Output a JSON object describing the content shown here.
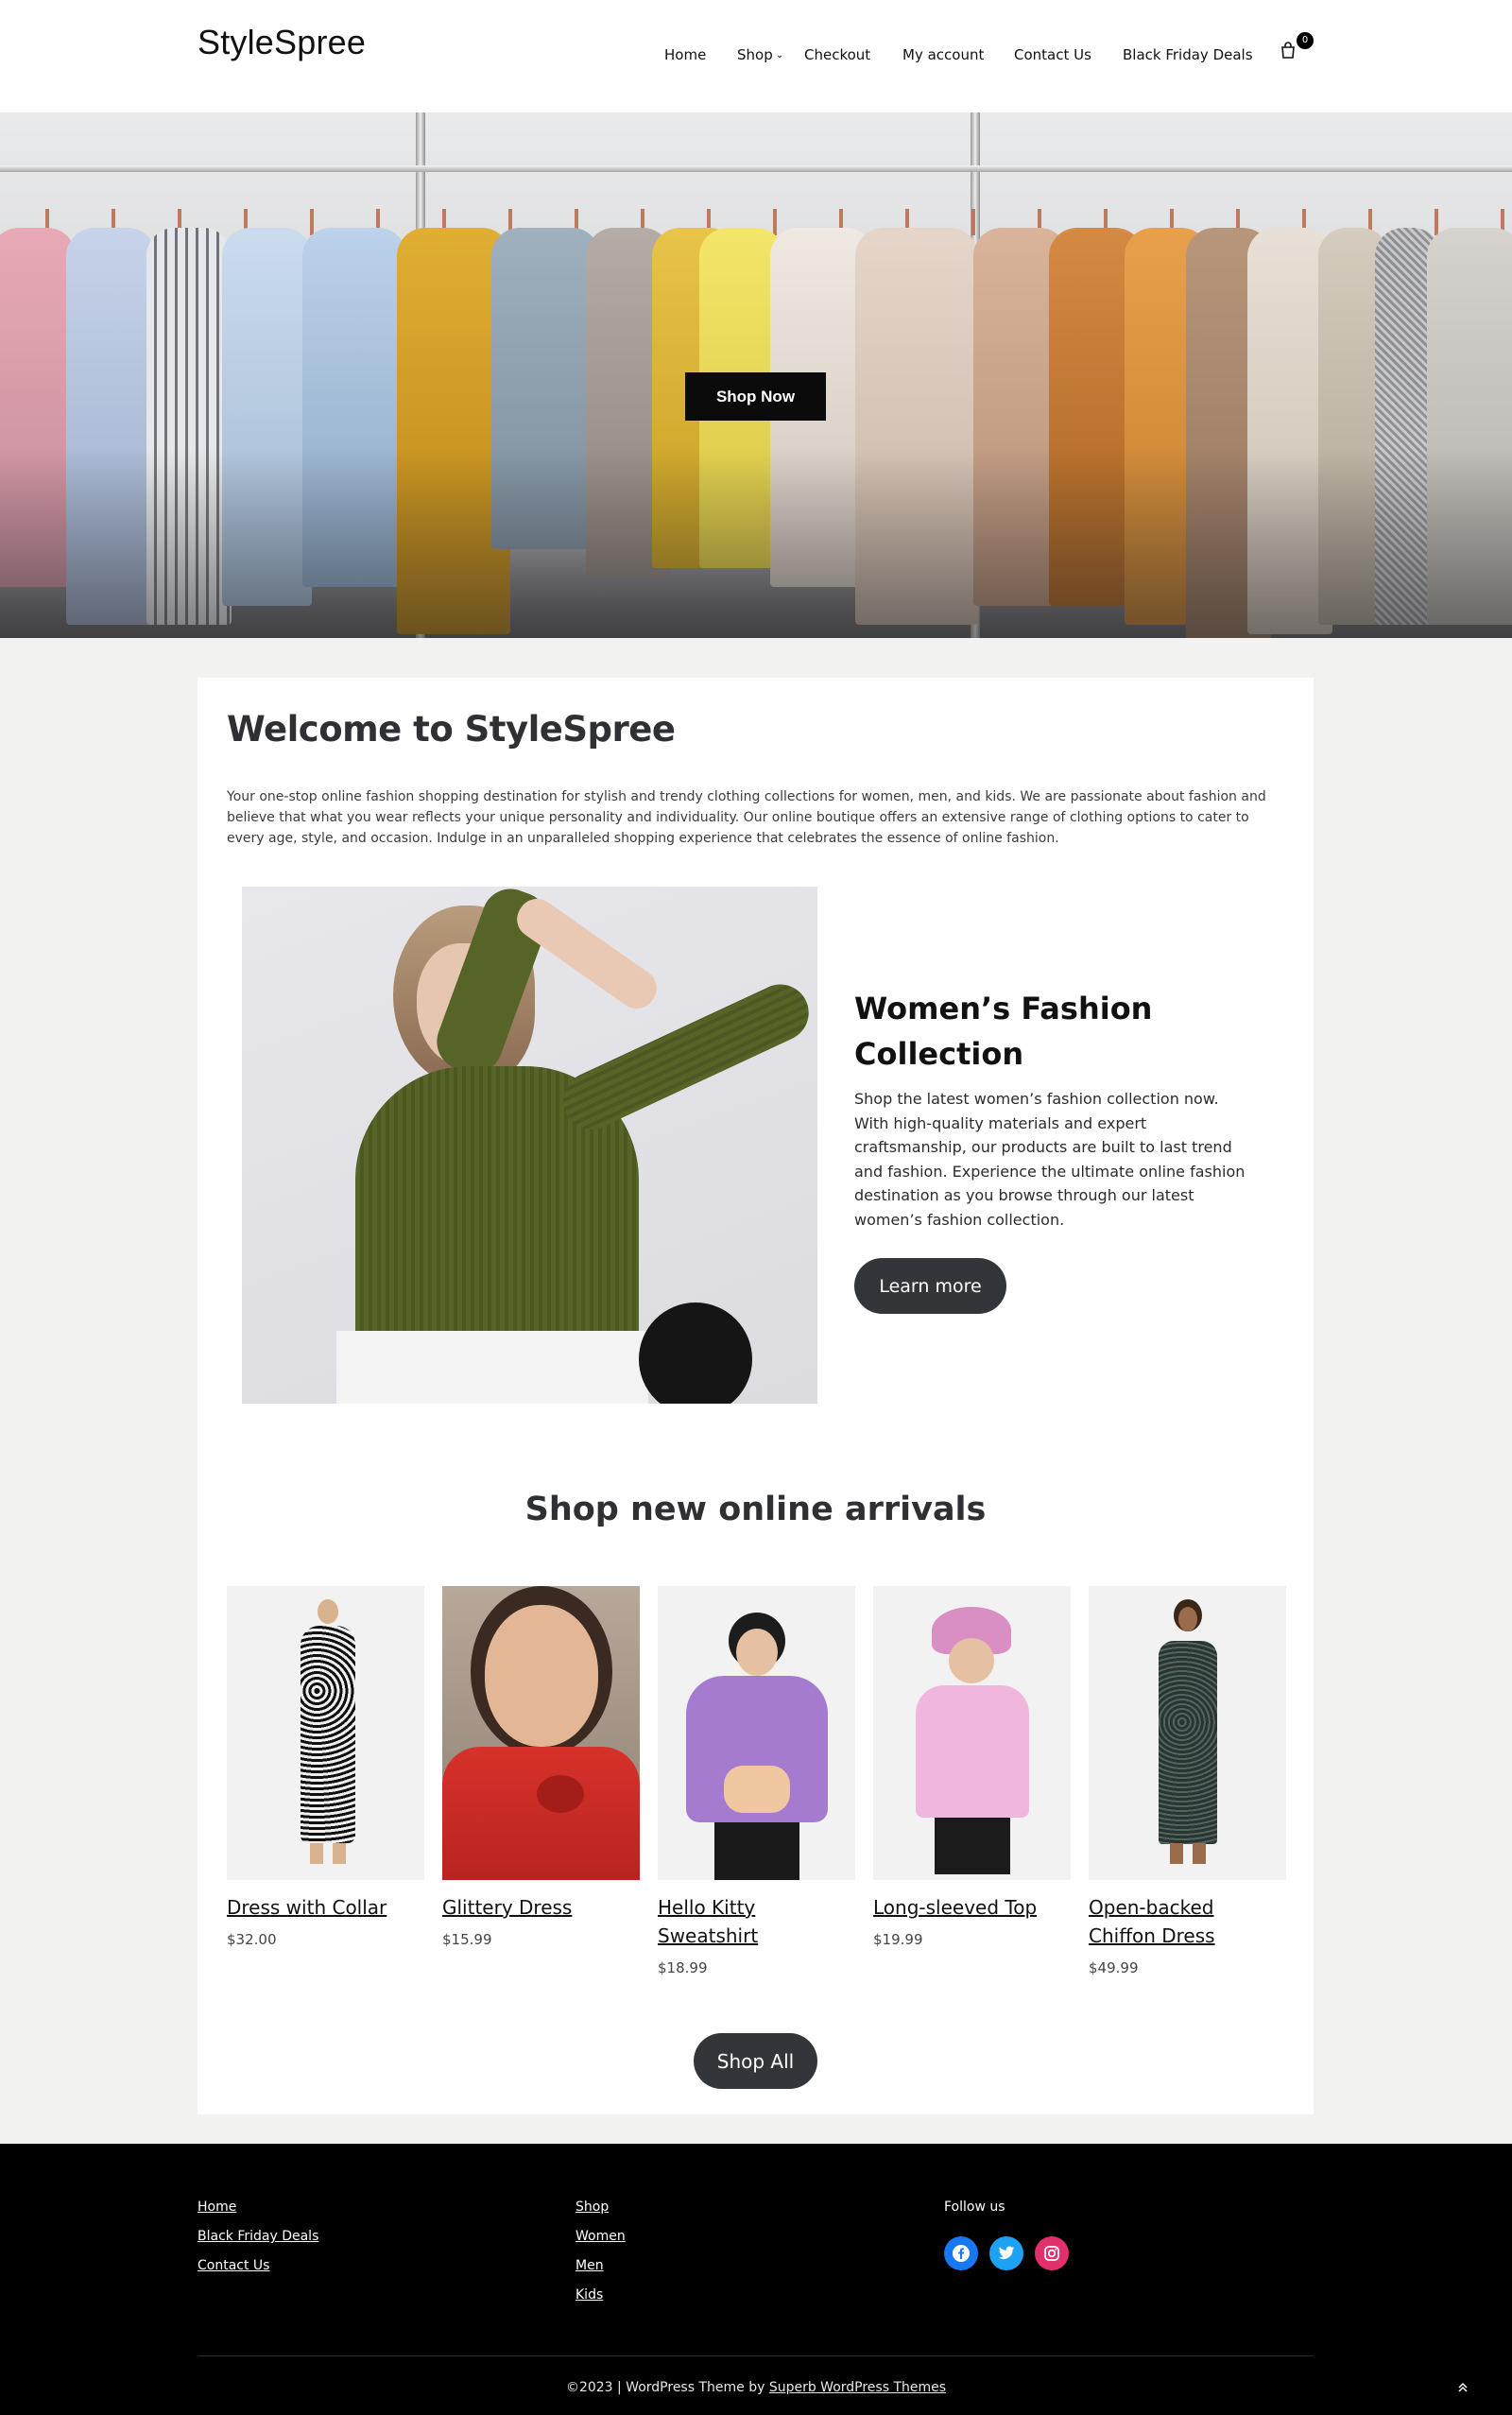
{
  "header": {
    "site_title": "StyleSpree",
    "nav": [
      {
        "label": "Home"
      },
      {
        "label": "Shop",
        "has_dropdown": true
      },
      {
        "label": "Checkout"
      },
      {
        "label": "My account"
      },
      {
        "label": "Contact Us"
      },
      {
        "label": "Black Friday Deals"
      }
    ],
    "cart_count": "0",
    "cart_icon": "shopping-bag-icon"
  },
  "hero": {
    "button_label": "Shop Now"
  },
  "welcome": {
    "title": "Welcome to StyleSpree",
    "text": "Your one-stop online fashion shopping destination for stylish and trendy clothing collections for women, men, and kids. We are passionate about fashion and believe that what you wear reflects your unique personality and individuality. Our online boutique offers an extensive range of clothing options to cater to every age, style, and occasion. Indulge in an unparalleled shopping experience that celebrates the essence of online fashion."
  },
  "feature": {
    "title": "Women’s Fashion Collection",
    "text": "Shop the latest women’s fashion collection now. With high-quality materials and expert craftsmanship, our products are built to last trend and fashion. Experience the ultimate online fashion destination as you browse through our latest women’s fashion collection.",
    "button_label": "Learn more"
  },
  "arrivals": {
    "title": "Shop new online arrivals",
    "products": [
      {
        "name": "Dress with Collar",
        "price": "$32.00"
      },
      {
        "name": "Glittery Dress",
        "price": "$15.99"
      },
      {
        "name": "Hello Kitty Sweatshirt",
        "price": "$18.99"
      },
      {
        "name": "Long-sleeved Top",
        "price": "$19.99"
      },
      {
        "name": "Open-backed Chiffon Dress",
        "price": "$49.99"
      }
    ],
    "shop_all_label": "Shop All"
  },
  "footer": {
    "col1": [
      "Home",
      "Black Friday Deals",
      "Contact Us"
    ],
    "col2": [
      "Shop",
      "Women",
      "Men",
      "Kids"
    ],
    "follow_label": "Follow us",
    "socials": [
      {
        "icon": "facebook-icon",
        "color": "#1877f2"
      },
      {
        "icon": "twitter-icon",
        "color": "#1da1f2"
      },
      {
        "icon": "instagram-icon",
        "color": "#e1306c"
      }
    ],
    "copyright_prefix": "©2023 | WordPress Theme by ",
    "copyright_link": "Superb WordPress Themes",
    "back_to_top_icon": "chevron-up-icon"
  }
}
